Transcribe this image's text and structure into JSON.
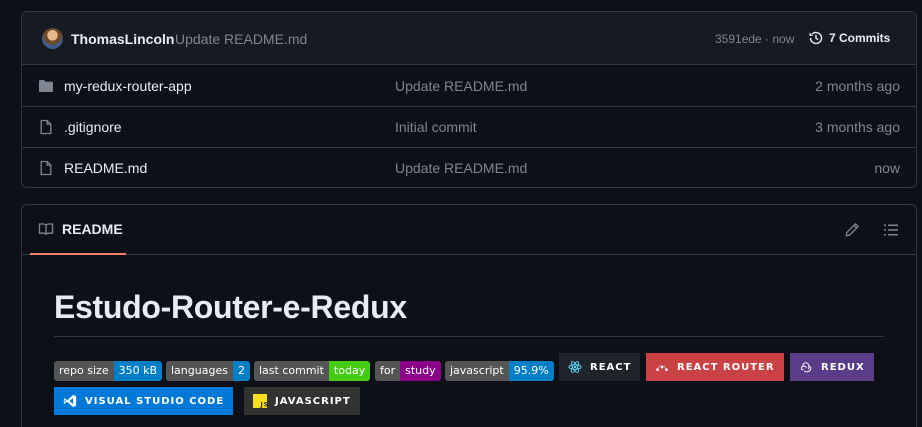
{
  "latest_commit": {
    "author": "ThomasLincoln",
    "message": "Update README.md",
    "sha_time": "3591ede · now",
    "commits_label": "7 Commits"
  },
  "files": [
    {
      "name": "my-redux-router-app",
      "type": "folder",
      "message": "Update README.md",
      "date": "2 months ago"
    },
    {
      "name": ".gitignore",
      "type": "file",
      "message": "Initial commit",
      "date": "3 months ago"
    },
    {
      "name": "README.md",
      "type": "file",
      "message": "Update README.md",
      "date": "now"
    }
  ],
  "readme": {
    "tab_label": "README",
    "title": "Estudo-Router-e-Redux"
  },
  "badges": [
    {
      "label": "repo size",
      "value": "350 kB",
      "color": "#007ec6"
    },
    {
      "label": "languages",
      "value": "2",
      "color": "#007ec6"
    },
    {
      "label": "last commit",
      "value": "today",
      "color": "#4c1"
    },
    {
      "label": "for",
      "value": "study",
      "color": "#8a0089"
    },
    {
      "label": "javascript",
      "value": "95.9%",
      "color": "#007ec6"
    }
  ],
  "tech_badges": [
    {
      "label": "REACT",
      "color": "#20232a",
      "icon": "react-icon"
    },
    {
      "label": "REACT ROUTER",
      "color": "#ca4245",
      "icon": "react-router-icon"
    },
    {
      "label": "REDUX",
      "color": "#593d88",
      "icon": "redux-icon"
    },
    {
      "label": "VISUAL STUDIO CODE",
      "color": "#0078d7",
      "icon": "vscode-icon"
    },
    {
      "label": "JAVASCRIPT",
      "color": "#323330",
      "icon": "javascript-icon"
    }
  ],
  "colors": {
    "background": "#0d1117",
    "border": "#30363d",
    "muted_text": "#7d8590",
    "accent_underline": "#f78166"
  }
}
